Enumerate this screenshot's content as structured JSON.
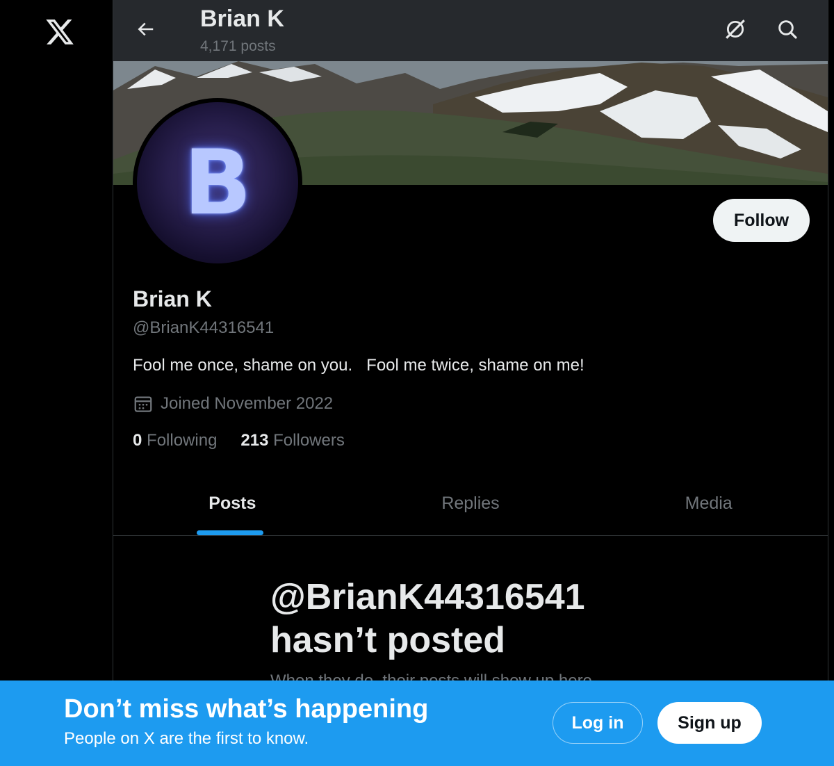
{
  "brand": {
    "logo_icon": "x-logo-icon"
  },
  "header": {
    "name": "Brian K",
    "post_count": "4,171 posts",
    "back_icon": "arrow-left-icon",
    "grok_icon": "grok-icon",
    "search_icon": "search-icon"
  },
  "profile": {
    "avatar_letter": "B",
    "follow_label": "Follow",
    "name": "Brian K",
    "handle": "@BrianK44316541",
    "bio": "Fool me once, shame on you.   Fool me twice, shame on me!",
    "joined": "Joined November 2022",
    "following_count": "0",
    "following_label": "Following",
    "followers_count": "213",
    "followers_label": "Followers"
  },
  "tabs": [
    {
      "label": "Posts",
      "active": true
    },
    {
      "label": "Replies",
      "active": false
    },
    {
      "label": "Media",
      "active": false
    }
  ],
  "empty_state": {
    "title_line1": "@BrianK44316541",
    "title_line2": "hasn’t posted",
    "subtitle": "When they do, their posts will show up here."
  },
  "bottom_bar": {
    "title": "Don’t miss what’s happening",
    "subtitle": "People on X are the first to know.",
    "login_label": "Log in",
    "signup_label": "Sign up"
  },
  "colors": {
    "accent": "#1d9bf0",
    "background": "#000000",
    "text_primary": "#e7e9ea",
    "text_secondary": "#71767b"
  }
}
